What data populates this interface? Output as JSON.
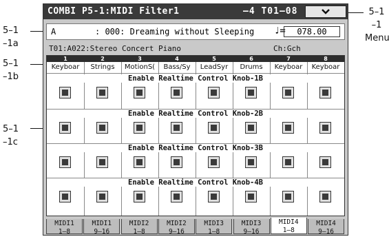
{
  "callouts": {
    "menu": [
      "5–1",
      "–1",
      "Menu"
    ],
    "a": [
      "5–1",
      "–1a"
    ],
    "b": [
      "5–1",
      "–1b"
    ],
    "c": [
      "5–1",
      "–1c"
    ]
  },
  "titlebar": {
    "title": "COMBI P5-1:MIDI Filter1",
    "position": "–4 T01–08",
    "menu_icon": "chevron-down-icon"
  },
  "combi": {
    "bank": "A",
    "name": ": 000: Dreaming without Sleeping",
    "note_symbol": "♩=",
    "tempo": "078.00"
  },
  "timbre": {
    "info": "T01:A022:Stereo Concert Piano",
    "channel": "Ch:Gch"
  },
  "timbres": [
    {
      "num": "1",
      "name": "Keyboar"
    },
    {
      "num": "2",
      "name": "Strings"
    },
    {
      "num": "3",
      "name": "MotionS("
    },
    {
      "num": "4",
      "name": "Bass/Sy"
    },
    {
      "num": "5",
      "name": "LeadSyr"
    },
    {
      "num": "6",
      "name": "Drums"
    },
    {
      "num": "7",
      "name": "Keyboar"
    },
    {
      "num": "8",
      "name": "Keyboar"
    }
  ],
  "sections": [
    {
      "label": "Enable Realtime Control Knob-1B"
    },
    {
      "label": "Enable Realtime Control Knob-2B"
    },
    {
      "label": "Enable Realtime Control Knob-3B"
    },
    {
      "label": "Enable Realtime Control Knob-4B"
    }
  ],
  "tabs": [
    {
      "l1": "MIDI1",
      "l2": "1–8",
      "active": false
    },
    {
      "l1": "MIDI1",
      "l2": "9–16",
      "active": false
    },
    {
      "l1": "MIDI2",
      "l2": "1–8",
      "active": false
    },
    {
      "l1": "MIDI2",
      "l2": "9–16",
      "active": false
    },
    {
      "l1": "MIDI3",
      "l2": "1–8",
      "active": false
    },
    {
      "l1": "MIDI3",
      "l2": "9–16",
      "active": false
    },
    {
      "l1": "MIDI4",
      "l2": "1–8",
      "active": true
    },
    {
      "l1": "MIDI4",
      "l2": "9–16",
      "active": false
    }
  ]
}
